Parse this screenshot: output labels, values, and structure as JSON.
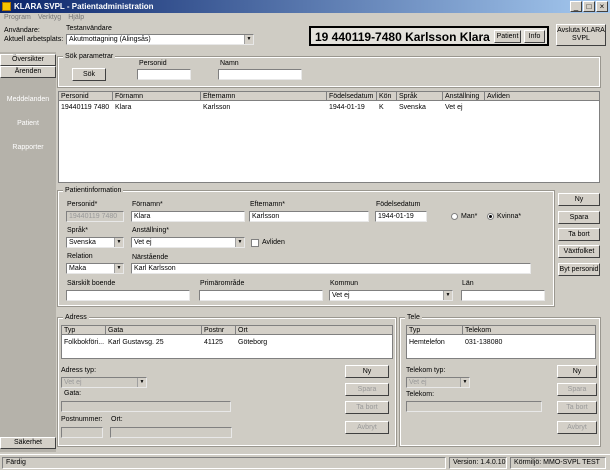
{
  "window": {
    "title": "KLARA SVPL - Patientadministration"
  },
  "menu": [
    "Program",
    "Verktyg",
    "Hjälp"
  ],
  "context": {
    "user_label": "Användare:",
    "workplace_label": "Aktuell arbetsplats:",
    "caregiver_label": "Testanvändare",
    "workplace_value": "Akutmottagning (Alingsås)"
  },
  "patient_header": {
    "id_name": "19 440119-7480 Karlsson Klara",
    "patient_button": "Patient",
    "info_button": "Info",
    "exit_button": "Avsluta KLARA SVPL"
  },
  "sidebar": {
    "overview": "Översikter",
    "errands": "Ärenden",
    "items": [
      "Meddelanden",
      "Patient",
      "Rapporter"
    ],
    "security": "Säkerhet"
  },
  "search": {
    "legend": "Sök parametrar",
    "button": "Sök",
    "personid_label": "Personid",
    "name_label": "Namn",
    "personid_value": "",
    "name_value": ""
  },
  "results": {
    "columns": [
      "Personid",
      "Förnamn",
      "Efternamn",
      "Födelsedatum",
      "Kön",
      "Språk",
      "Anställning",
      "Avliden"
    ],
    "rows": [
      [
        "19440119 7480",
        "Klara",
        "Karlsson",
        "1944-01-19",
        "K",
        "Svenska",
        "Vet ej",
        ""
      ]
    ]
  },
  "patient_info": {
    "legend": "Patientinformation",
    "personid_label": "Personid*",
    "personid_value": "19440119 7480",
    "firstname_label": "Förnamn*",
    "firstname_value": "Klara",
    "lastname_label": "Efternamn*",
    "lastname_value": "Karlsson",
    "birthdate_label": "Födelsedatum",
    "birthdate_value": "1944-01-19",
    "gender_male": "Man*",
    "gender_female": "Kvinna*",
    "gender_selected": "Kvinna",
    "language_label": "Språk*",
    "language_value": "Svenska",
    "employment_label": "Anställning*",
    "employment_value": "Vet ej",
    "deceased_label": "Avliden",
    "relation_label": "Relation",
    "relation_value": "Maka",
    "relative_label": "Närstående",
    "relative_value": "Karl Karlsson",
    "special_housing_label": "Särskilt boende",
    "special_housing_value": "",
    "primary_area_label": "Primärområde",
    "primary_area_value": "",
    "municipality_label": "Kommun",
    "municipality_value": "Vet ej",
    "county_label": "Län",
    "county_value": ""
  },
  "patient_buttons": [
    "Ny",
    "Spara",
    "Ta bort",
    "Växtfolket",
    "Byt personid"
  ],
  "address": {
    "legend": "Adress",
    "columns": [
      "Typ",
      "Gata",
      "Postnr",
      "Ort"
    ],
    "rows": [
      [
        "Folkbokföri...",
        "Karl Gustavsg. 25",
        "41125",
        "Göteborg"
      ]
    ],
    "type_label": "Adress typ:",
    "type_value": "Vet ej",
    "street_label": "Gata:",
    "postal_label": "Postnummer:",
    "city_label": "Ort:",
    "buttons": [
      "Ny",
      "Spara",
      "Ta bort",
      "Avbryt"
    ]
  },
  "phone": {
    "legend": "Tele",
    "columns": [
      "Typ",
      "Telekom"
    ],
    "rows": [
      [
        "Hemtelefon",
        "031-138080"
      ]
    ],
    "type_label": "Telekom typ:",
    "type_value": "Vet ej",
    "number_label": "Telekom:",
    "buttons": [
      "Ny",
      "Spara",
      "Ta bort",
      "Avbryt"
    ]
  },
  "status": {
    "left": "Färdig",
    "version": "Version: 1.4.0.10",
    "environment": "Körmiljö: MMO-SVPL TEST"
  }
}
